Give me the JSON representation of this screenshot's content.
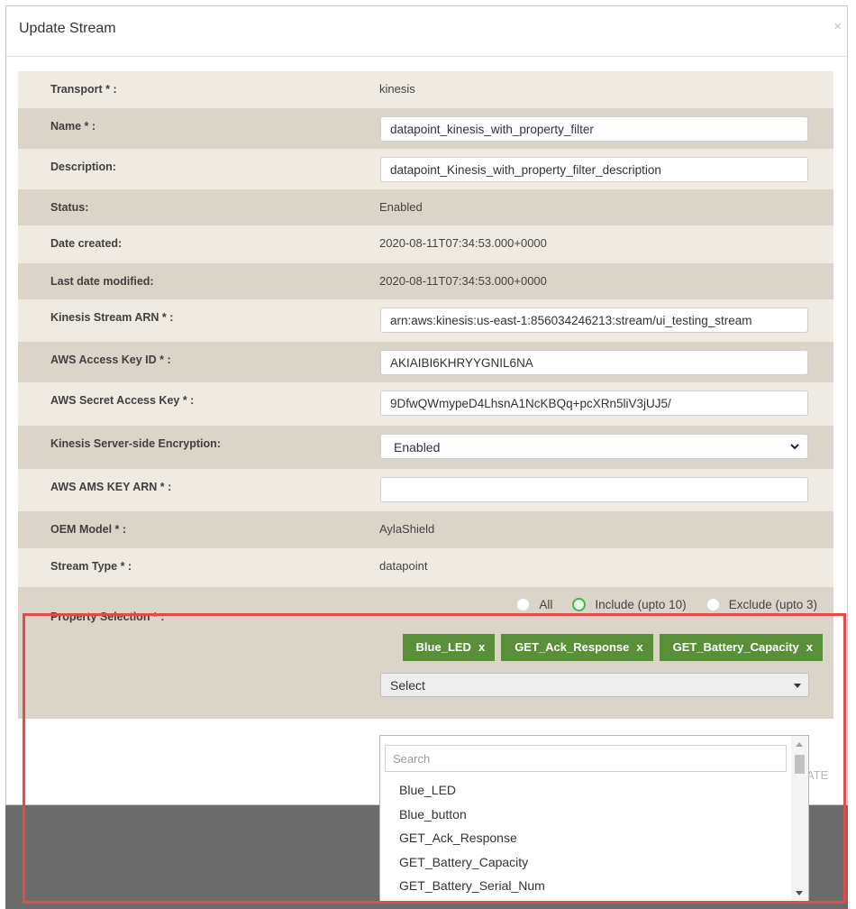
{
  "modal": {
    "title": "Update Stream",
    "close_glyph": "×"
  },
  "rows": {
    "transport": {
      "label": "Transport * :",
      "value": "kinesis"
    },
    "name": {
      "label": "Name * :",
      "value": "datapoint_kinesis_with_property_filter"
    },
    "description": {
      "label": "Description:",
      "value": "datapoint_Kinesis_with_property_filter_description"
    },
    "status": {
      "label": "Status:",
      "value": "Enabled"
    },
    "date_created": {
      "label": "Date created:",
      "value": "2020-08-11T07:34:53.000+0000"
    },
    "last_modified": {
      "label": "Last date modified:",
      "value": "2020-08-11T07:34:53.000+0000"
    },
    "stream_arn": {
      "label": "Kinesis Stream ARN * :",
      "value": "arn:aws:kinesis:us-east-1:856034246213:stream/ui_testing_stream"
    },
    "access_key": {
      "label": "AWS Access Key ID * :",
      "value": "AKIAIBI6KHRYYGNIL6NA"
    },
    "secret_key": {
      "label": "AWS Secret Access Key * :",
      "value": "9DfwQWmypeD4LhsnA1NcKBQq+pcXRn5liV3jUJ5/"
    },
    "encryption": {
      "label": "Kinesis Server-side Encryption:",
      "value": "Enabled"
    },
    "kms_arn": {
      "label": "AWS AMS KEY ARN * :",
      "value": ""
    },
    "oem_model": {
      "label": "OEM Model * :",
      "value": "AylaShield"
    },
    "stream_type": {
      "label": "Stream Type * :",
      "value": "datapoint"
    }
  },
  "property_selection": {
    "label": "Property Selection * :",
    "radio_options": [
      {
        "label": "All",
        "checked": false
      },
      {
        "label": "Include (upto 10)",
        "checked": true
      },
      {
        "label": "Exclude (upto 3)",
        "checked": false
      }
    ],
    "tags": [
      "Blue_LED",
      "GET_Ack_Response",
      "GET_Battery_Capacity"
    ],
    "tag_remove_glyph": "x",
    "select_text": "Select"
  },
  "footer": {
    "update_button_partial": "ATE"
  },
  "dropdown": {
    "search_placeholder": "Search",
    "items": [
      "Blue_LED",
      "Blue_button",
      "GET_Ack_Response",
      "GET_Battery_Capacity",
      "GET_Battery_Serial_Num"
    ]
  },
  "colors": {
    "row_light": "#efeae2",
    "row_dark": "#dbd4c8",
    "tag_green": "#5a8f3a",
    "highlight_red": "#e34a4a"
  }
}
